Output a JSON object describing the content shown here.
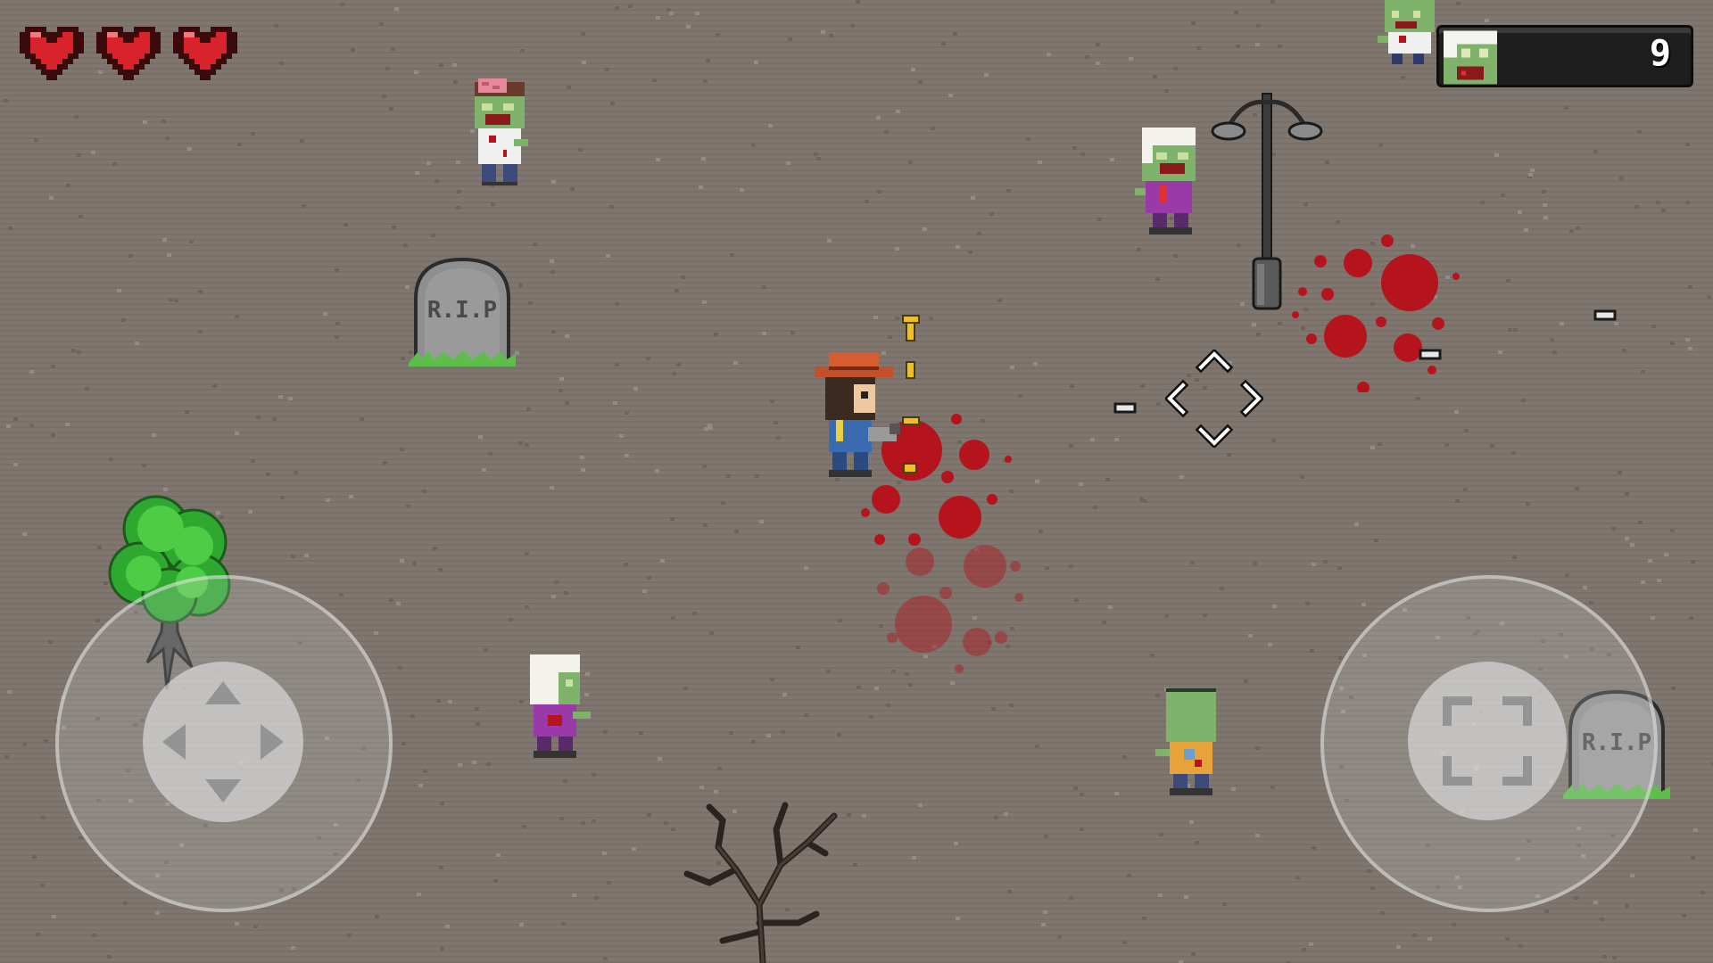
{
  "hud": {
    "hearts": [
      {
        "icon": "heart-icon",
        "filled": true
      },
      {
        "icon": "heart-icon",
        "filled": true
      },
      {
        "icon": "heart-icon",
        "filled": true
      }
    ],
    "zombie_counter": {
      "icon": "zombie-face-icon",
      "value": "9"
    }
  },
  "world": {
    "gravestones": [
      {
        "inscription": "R.I.P"
      },
      {
        "inscription": "R.I.P"
      }
    ]
  },
  "controls": {
    "move_joystick": {
      "icon": "dpad-arrows-icon"
    },
    "aim_joystick": {
      "icon": "crosshair-brackets-icon"
    }
  },
  "colors": {
    "ground": "#7e766f",
    "blood": "#b5141c",
    "heart": "#d8232a",
    "zombie_skin": "#7fb26a",
    "ammo": "#f2c01e"
  }
}
